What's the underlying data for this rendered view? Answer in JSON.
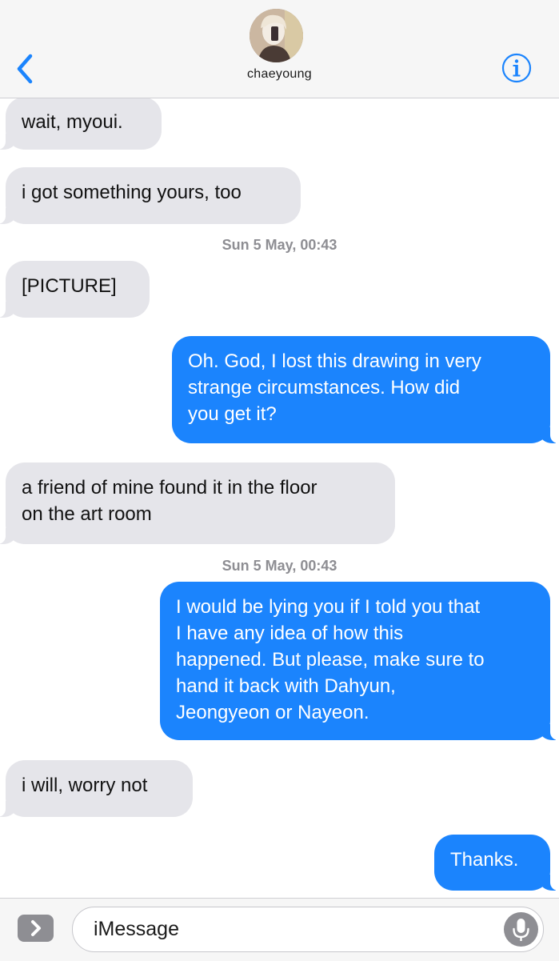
{
  "header": {
    "contact_name": "chaeyoung",
    "back_icon": "chevron-left-icon",
    "info_icon": "info-icon",
    "accent_color": "#1b84fd"
  },
  "messages": [
    {
      "direction": "incoming",
      "text": "wait, myoui."
    },
    {
      "direction": "incoming",
      "text": "i got something yours, too"
    },
    {
      "type": "timestamp",
      "text": "Sun 5 May, 00:43"
    },
    {
      "direction": "incoming",
      "text": "[PICTURE]"
    },
    {
      "direction": "outgoing",
      "lines": [
        "Oh. God, I lost this drawing in very",
        "strange circumstances. How did",
        "you get it?"
      ]
    },
    {
      "direction": "incoming",
      "lines": [
        "a friend of mine found it in the floor",
        "on the art room"
      ]
    },
    {
      "type": "timestamp",
      "text": "Sun 5 May, 00:43"
    },
    {
      "direction": "outgoing",
      "lines": [
        "I would be lying you if I told you that",
        "I have any idea of how this",
        "happened. But please, make sure to",
        "hand it back with Dahyun,",
        "Jeongyeon or Nayeon."
      ]
    },
    {
      "direction": "incoming",
      "text": "i will, worry not"
    },
    {
      "direction": "outgoing",
      "text": "Thanks."
    }
  ],
  "composer": {
    "placeholder": "iMessage",
    "apps_icon": "chevron-right-icon",
    "mic_icon": "microphone-icon"
  },
  "colors": {
    "incoming_bubble": "#e5e5ea",
    "outgoing_bubble": "#1b84fd",
    "timestamp": "#8e8e93"
  }
}
